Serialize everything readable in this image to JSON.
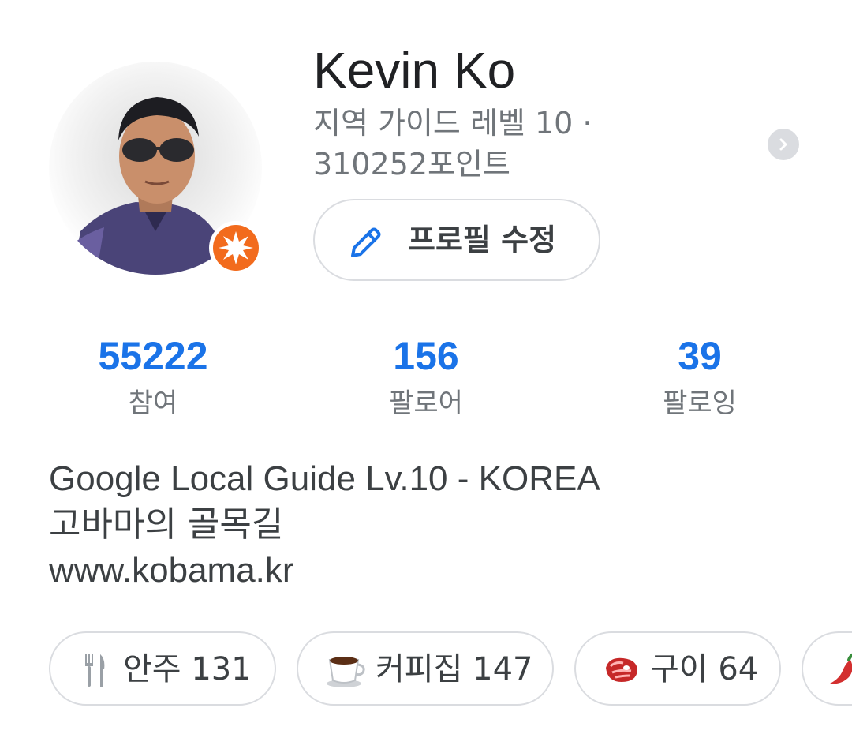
{
  "profile": {
    "name": "Kevin Ko",
    "level_line1": "지역 가이드 레벨 10 ·",
    "level_line2": "310252포인트",
    "edit_button_label": "프로필 수정"
  },
  "stats": [
    {
      "value": "55222",
      "label": "참여"
    },
    {
      "value": "156",
      "label": "팔로어"
    },
    {
      "value": "39",
      "label": "팔로잉"
    }
  ],
  "bio": {
    "line1": "Google Local Guide Lv.10 - KOREA",
    "line2": "고바마의 골목길",
    "line3": "www.kobama.kr"
  },
  "chips": [
    {
      "icon": "fork-knife-icon",
      "label": "안주 131"
    },
    {
      "icon": "coffee-cup-icon",
      "label": "커피집 147"
    },
    {
      "icon": "steak-icon",
      "label": "구이 64"
    },
    {
      "icon": "chili-pepper-icon",
      "label": ""
    }
  ],
  "colors": {
    "accent": "#1a73e8",
    "badge": "#f26b1d",
    "text_primary": "#202124",
    "text_secondary": "#70757a",
    "border": "#dadce0"
  }
}
